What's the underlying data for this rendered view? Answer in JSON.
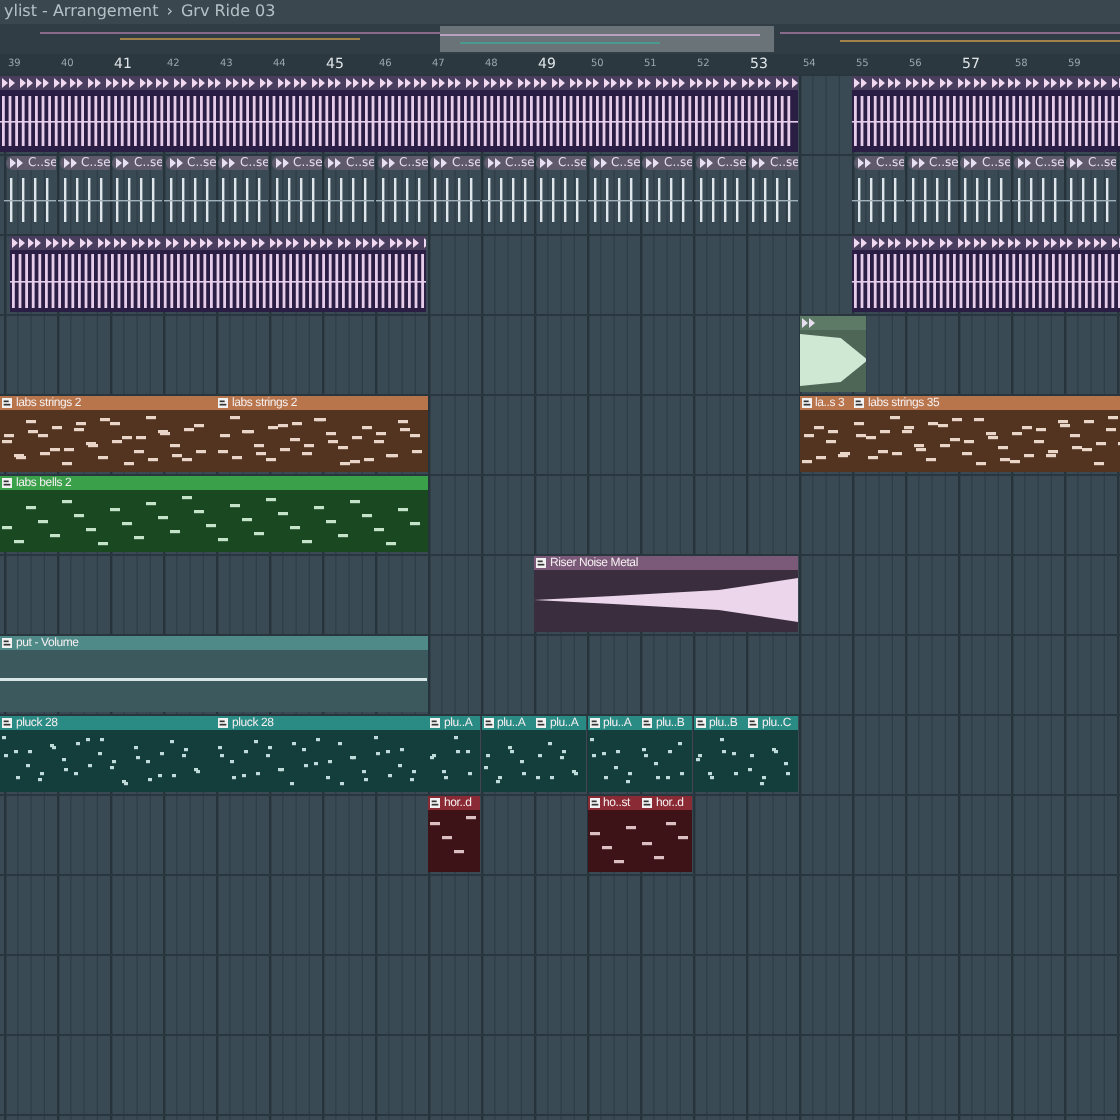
{
  "title": {
    "window": "ylist - Arrangement",
    "separator": "›",
    "pattern": "Grv Ride 03"
  },
  "ruler": [
    {
      "label": "39",
      "major": false
    },
    {
      "label": "40",
      "major": false
    },
    {
      "label": "41",
      "major": true
    },
    {
      "label": "42",
      "major": false
    },
    {
      "label": "43",
      "major": false
    },
    {
      "label": "44",
      "major": false
    },
    {
      "label": "45",
      "major": true
    },
    {
      "label": "46",
      "major": false
    },
    {
      "label": "47",
      "major": false
    },
    {
      "label": "48",
      "major": false
    },
    {
      "label": "49",
      "major": true
    },
    {
      "label": "50",
      "major": false
    },
    {
      "label": "51",
      "major": false
    },
    {
      "label": "52",
      "major": false
    },
    {
      "label": "53",
      "major": true
    },
    {
      "label": "54",
      "major": false
    },
    {
      "label": "55",
      "major": false
    },
    {
      "label": "56",
      "major": false
    },
    {
      "label": "57",
      "major": true
    },
    {
      "label": "58",
      "major": false
    },
    {
      "label": "59",
      "major": false
    }
  ],
  "tracks": [
    {
      "kind": "beats",
      "color": "#4a3e5e",
      "clips": [
        {
          "kind": "beats"
        },
        {
          "kind": "beats"
        }
      ]
    },
    {
      "kind": "sample",
      "color": "#5e5a6c",
      "clips": [
        {
          "name": "C..se"
        },
        {
          "name": "C..se"
        },
        {
          "name": "C..se"
        },
        {
          "name": "C..se"
        },
        {
          "name": "C..se"
        },
        {
          "name": "C..se"
        },
        {
          "name": "C..se"
        },
        {
          "name": "C..se"
        },
        {
          "name": "C..se"
        },
        {
          "name": "C..se"
        },
        {
          "name": "C..se"
        },
        {
          "name": "C..se"
        },
        {
          "name": "C..se"
        },
        {
          "name": "C..se"
        },
        {
          "name": "C..se"
        },
        {
          "name": "C..se"
        },
        {
          "name": "C..se"
        },
        {
          "name": "C..se"
        },
        {
          "name": "C..se"
        },
        {
          "name": "C..se"
        }
      ]
    },
    {
      "kind": "beats",
      "color": "#4a3e5e",
      "clips": [
        {
          "kind": "beats"
        },
        {
          "kind": "beats"
        }
      ]
    },
    {
      "kind": "audio",
      "color": "#5d7a66",
      "clips": [
        {
          "kind": "audio"
        }
      ]
    },
    {
      "kind": "pattern",
      "color": "#b8744a",
      "clips": [
        {
          "name": "labs strings 2"
        },
        {
          "name": "labs strings 2"
        },
        {
          "name": "la..s 3"
        },
        {
          "name": "labs strings 35"
        }
      ]
    },
    {
      "kind": "pattern",
      "color": "#3aa04a",
      "clips": [
        {
          "name": "labs bells 2"
        }
      ]
    },
    {
      "kind": "riser",
      "color": "#7a5a78",
      "clips": [
        {
          "name": "Riser Noise Metal"
        }
      ]
    },
    {
      "kind": "automation",
      "color": "#4f8a88",
      "clips": [
        {
          "name": "put - Volume"
        }
      ]
    },
    {
      "kind": "pattern",
      "color": "#2a8a84",
      "clips": [
        {
          "name": "pluck 28"
        },
        {
          "name": "pluck 28"
        },
        {
          "name": "plu..A"
        },
        {
          "name": "plu..A"
        },
        {
          "name": "plu..A"
        },
        {
          "name": "plu..A"
        },
        {
          "name": "plu..B"
        },
        {
          "name": "plu..B"
        },
        {
          "name": "plu..C"
        }
      ]
    },
    {
      "kind": "pattern",
      "color": "#8a2a34",
      "clips": [
        {
          "name": "hor..d"
        },
        {
          "name": "ho..st"
        },
        {
          "name": "hor..d"
        }
      ]
    }
  ]
}
